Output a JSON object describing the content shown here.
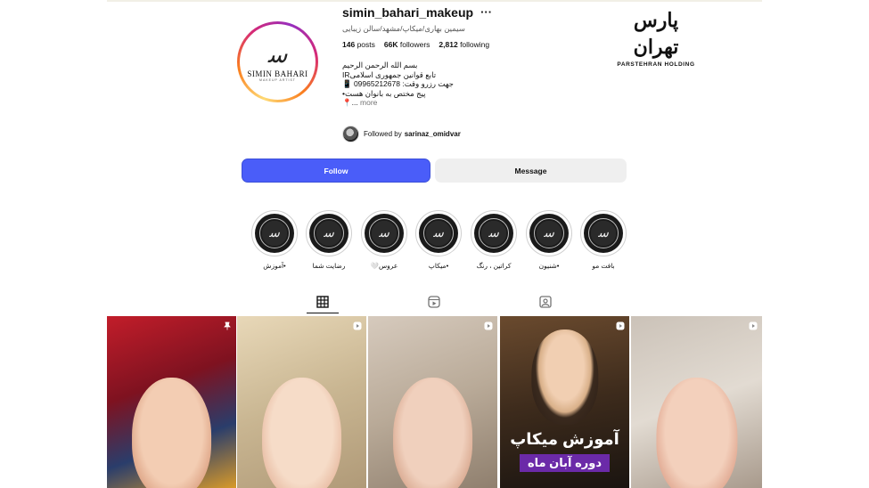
{
  "watermark": {
    "logo_text": "پارس تهران",
    "subtitle": "PARSTEHRAN HOLDING"
  },
  "profile": {
    "avatar_title": "SIMIN BAHARI",
    "avatar_tag": "MAKEUP ARTIST",
    "avatar_mark": "ﺳ",
    "username": "simin_bahari_makeup",
    "more_icon": "ellipsis-icon",
    "category": "سیمین بهاری/میکاپ/مشهد/سالن زیبایی",
    "stats": {
      "posts": "146",
      "posts_label": "posts",
      "followers": "66K",
      "followers_label": "followers",
      "following": "2,812",
      "following_label": "following"
    },
    "bio_lines": [
      "بسم الله الرحمن الرحیم",
      "تابع قوانین جمهوری اسلامیIR",
      "جهت رزرو وقت: 09965212678 📱",
      "پیج مختص به بانوان هست•",
      "📍..."
    ],
    "bio_more": "more",
    "followed_by_prefix": "Followed by",
    "followed_by_user": "sarinaz_omidvar"
  },
  "actions": {
    "follow_label": "Follow",
    "message_label": "Message"
  },
  "highlights": [
    {
      "label": "بافت مو"
    },
    {
      "label": "•شنیون"
    },
    {
      "label": "کراتین ، رنگ"
    },
    {
      "label": "•میکاپ"
    },
    {
      "label": "عروس🤍"
    },
    {
      "label": "رضایت شما"
    },
    {
      "label": "•آموزش"
    }
  ],
  "tabs": [
    {
      "name": "posts",
      "icon": "grid-icon",
      "active": true
    },
    {
      "name": "reels",
      "icon": "reels-icon",
      "active": false
    },
    {
      "name": "tagged",
      "icon": "tagged-icon",
      "active": false
    }
  ],
  "posts": [
    {
      "badge": "pin-icon",
      "caption": ""
    },
    {
      "badge": "reel-icon",
      "caption": ""
    },
    {
      "badge": "reel-icon",
      "caption": ""
    },
    {
      "badge": "reel-icon",
      "caption": "آموزش میکاپ",
      "caption2": "دوره آبان ماه"
    },
    {
      "badge": "reel-icon",
      "caption": ""
    }
  ]
}
